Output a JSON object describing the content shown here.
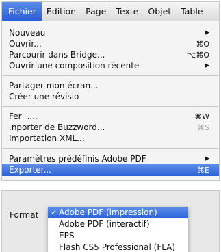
{
  "menubar": {
    "items": [
      {
        "label": "Fichier",
        "active": true
      },
      {
        "label": "Edition"
      },
      {
        "label": "Page"
      },
      {
        "label": "Texte"
      },
      {
        "label": "Objet"
      },
      {
        "label": "Table"
      }
    ]
  },
  "file_menu": {
    "items": [
      {
        "label": "Nouveau",
        "submenu": true
      },
      {
        "label": "Ouvrir...",
        "shortcut": "⌘O"
      },
      {
        "label": "Parcourir dans Bridge...",
        "shortcut": "⌥⌘O"
      },
      {
        "label": "Ouvrir une composition récente",
        "submenu": true
      },
      {
        "label": "Partager mon écran..."
      },
      {
        "label": "Créer une révisio"
      },
      {
        "label": "Fer"
      },
      {
        "label": ".nporter de Buzzword...",
        "shortcut": "⌘S",
        "shortcut_disabled": true
      },
      {
        "label": "Importation XML..."
      },
      {
        "label": "Paramètres prédéfinis Adobe PDF",
        "submenu": true
      },
      {
        "label": "Exporter...",
        "shortcut": "⌘E",
        "highlighted": true
      }
    ],
    "fermer_shortcut": "⌘W",
    "fermer_extra": "...."
  },
  "export_dialog": {
    "format_label": "Format",
    "options": [
      {
        "label": "Adobe PDF (impression)",
        "selected": true,
        "check": "✓"
      },
      {
        "label": "Adobe PDF (interactif)"
      },
      {
        "label": "EPS"
      },
      {
        "label": "Flash CS5 Professional (FLA)"
      }
    ]
  },
  "colors": {
    "highlight": "#2d62d8",
    "menubar": "#dcdcdc"
  }
}
